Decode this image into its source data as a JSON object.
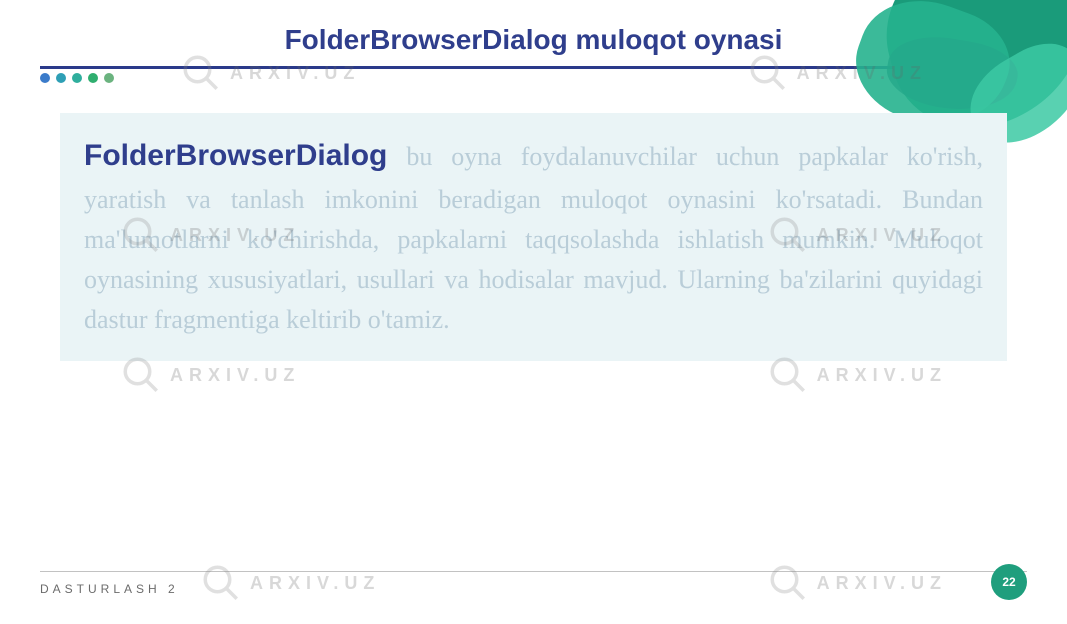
{
  "title": "FolderBrowserDialog muloqot oynasi",
  "content": {
    "lead": "FolderBrowserDialog",
    "body": " bu oyna foydalanuvchilar uchun papkalar ko'rish, yaratish va tanlash imkonini beradigan muloqot oynasini ko'rsatadi. Bundan ma'lumotlarni ko'chirishda, papkalarni taqqsolashda ishlatish mumkin. Muloqot oynasining xususiyatlari, usullari va hodisalar mavjud. Ularning ba'zilarini quyidagi dastur fragmentiga keltirib o'tamiz."
  },
  "footer_text": "DASTURLASH 2",
  "page_number": "22",
  "watermark_text": "ARXIV.UZ",
  "dot_colors": [
    "#3b7bca",
    "#2e9fb5",
    "#2fae9d",
    "#2fae6f",
    "#6bb37f"
  ]
}
